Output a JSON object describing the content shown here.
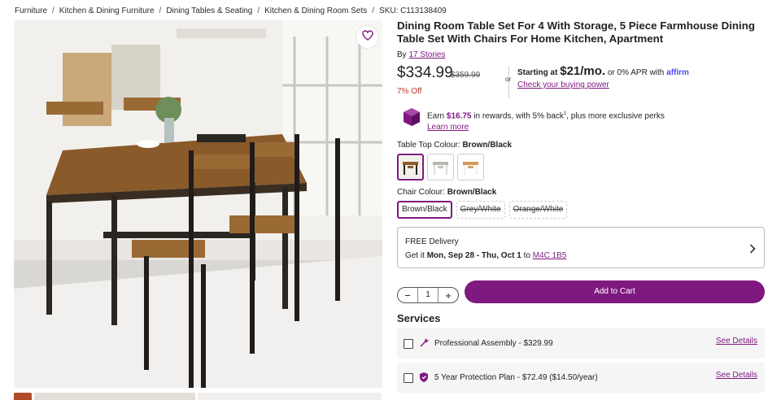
{
  "breadcrumb": {
    "items": [
      "Furniture",
      "Kitchen & Dining Furniture",
      "Dining Tables & Seating",
      "Kitchen & Dining Room Sets"
    ],
    "separator": "/",
    "sku": "SKU: C113138409"
  },
  "product": {
    "title": "Dining Room Table Set For 4 With Storage, 5 Piece Farmhouse Dining Table Set With Chairs For Home Kitchen, Apartment",
    "by_prefix": "By",
    "brand": "17 Stories",
    "price": "$334.99",
    "was_price": "$359.99",
    "discount": "7% Off",
    "favorite_icon": "heart-icon"
  },
  "financing": {
    "or": "or",
    "starting_at": "Starting at",
    "monthly": "$21/mo.",
    "apr_text": "or 0% APR with",
    "provider": "affirm",
    "link": "Check your buying power"
  },
  "rewards": {
    "earn": "Earn",
    "amount": "$16.75",
    "text1": "in rewards, with 5% back",
    "sup": "1",
    "text2": ", plus more exclusive perks",
    "link": "Learn more"
  },
  "options": {
    "table_top_label": "Table Top Colour:",
    "table_top_value": "Brown/Black",
    "chair_label": "Chair Colour:",
    "chair_value": "Brown/Black",
    "chairs": [
      "Brown/Black",
      "Grey/White",
      "Orange/White"
    ]
  },
  "delivery": {
    "line1": "FREE Delivery",
    "get_it": "Get it",
    "dates": "Mon, Sep 28 - Thu, Oct 1",
    "to": "to",
    "postal": "M4C 1B5"
  },
  "cart": {
    "quantity": "1",
    "minus": "−",
    "plus": "+",
    "add_label": "Add to Cart"
  },
  "services": {
    "heading": "Services",
    "items": [
      {
        "label": "Professional Assembly - $329.99",
        "icon": "wrench-icon",
        "link": "See Details"
      },
      {
        "label": "5 Year Protection Plan - $72.49 ($14.50/year)",
        "icon": "shield-icon",
        "link": "See Details"
      }
    ]
  },
  "colors": {
    "accent": "#7f187f",
    "discount": "#c0392b"
  }
}
